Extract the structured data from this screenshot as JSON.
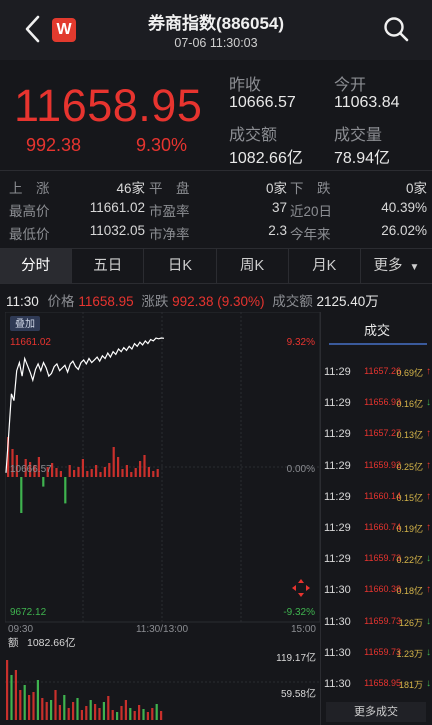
{
  "header": {
    "title": "券商指数(886054)",
    "datetime": "07-06 11:30:03",
    "logo_text": "W"
  },
  "quote": {
    "price": "11658.95",
    "change": "992.38",
    "change_pct": "9.30%",
    "prev_close_label": "昨收",
    "prev_close": "10666.57",
    "open_label": "今开",
    "open": "11063.84",
    "turnover_label": "成交额",
    "turnover": "1082.66亿",
    "volume_label": "成交量",
    "volume": "78.94亿"
  },
  "stats": {
    "rows": [
      [
        {
          "label": "上　涨",
          "value": "46家"
        },
        {
          "label": "平　盘",
          "value": "0家"
        },
        {
          "label": "下　跌",
          "value": "0家"
        }
      ],
      [
        {
          "label": "最高价",
          "value": "11661.02"
        },
        {
          "label": "市盈率",
          "value": "37"
        },
        {
          "label": "近20日",
          "value": "40.39%"
        }
      ],
      [
        {
          "label": "最低价",
          "value": "11032.05"
        },
        {
          "label": "市净率",
          "value": "2.3"
        },
        {
          "label": "今年来",
          "value": "26.02%"
        }
      ]
    ]
  },
  "tabs": [
    "分时",
    "五日",
    "日K",
    "周K",
    "月K",
    "更多"
  ],
  "info_line": {
    "time": "11:30",
    "price_label": "价格",
    "price": "11658.95",
    "change_label": "涨跌",
    "change": "992.38 (9.30%)",
    "turnover_label": "成交额",
    "turnover": "2125.40万"
  },
  "chart": {
    "overlay_button": "叠加",
    "high_label": "11661.02",
    "high_pct": "9.32%",
    "base_label": "10666.57",
    "base_pct": "0.00%",
    "low_label": "9672.12",
    "low_pct": "-9.32%",
    "time_start": "09:30",
    "time_mid": "11:30/13:00",
    "time_end": "15:00",
    "vol_title_label": "额",
    "vol_title_value": "1082.66亿",
    "vol_max": "119.17亿",
    "vol_mid": "59.58亿"
  },
  "chart_data": {
    "type": "line",
    "prices": [
      10668,
      10950,
      11250,
      11200,
      11420,
      11480,
      11380,
      11510,
      11460,
      11410,
      11350,
      11430,
      11470,
      11420,
      11480,
      11440,
      11380,
      11400,
      11450,
      11470,
      11420,
      11440,
      11460,
      11410,
      11470,
      11490,
      11450,
      11430,
      11480,
      11500,
      11470,
      11510,
      11480,
      11500,
      11520,
      11490,
      11530,
      11510,
      11550,
      11520,
      11560,
      11540,
      11580,
      11560,
      11590,
      11570,
      11600,
      11580,
      11620,
      11600,
      11630,
      11610,
      11640,
      11620,
      11650,
      11640,
      11660,
      11655,
      11661,
      11659
    ],
    "ylim": [
      9672.12,
      11661.02
    ],
    "base": 10666.57
  },
  "trades": {
    "header": "成交",
    "rows": [
      {
        "time": "11:29",
        "price": "11657.26",
        "vol": "0.69亿",
        "dir": "up"
      },
      {
        "time": "11:29",
        "price": "11656.93",
        "vol": "0.16亿",
        "dir": "down"
      },
      {
        "time": "11:29",
        "price": "11657.27",
        "vol": "0.13亿",
        "dir": "up"
      },
      {
        "time": "11:29",
        "price": "11659.92",
        "vol": "0.25亿",
        "dir": "up"
      },
      {
        "time": "11:29",
        "price": "11660.14",
        "vol": "0.15亿",
        "dir": "up"
      },
      {
        "time": "11:29",
        "price": "11660.74",
        "vol": "0.19亿",
        "dir": "up"
      },
      {
        "time": "11:29",
        "price": "11659.73",
        "vol": "0.22亿",
        "dir": "down"
      },
      {
        "time": "11:30",
        "price": "11660.38",
        "vol": "0.18亿",
        "dir": "up"
      },
      {
        "time": "11:30",
        "price": "11659.73",
        "vol": "126万",
        "dir": "down"
      },
      {
        "time": "11:30",
        "price": "11659.73",
        "vol": "1.23万",
        "dir": "down"
      },
      {
        "time": "11:30",
        "price": "11658.95",
        "vol": "181万",
        "dir": "down"
      }
    ],
    "more_label": "更多成交"
  },
  "colors": {
    "up": "#e7342f",
    "down": "#3fb34f",
    "bg": "#16171b",
    "line": "#ffffff"
  }
}
